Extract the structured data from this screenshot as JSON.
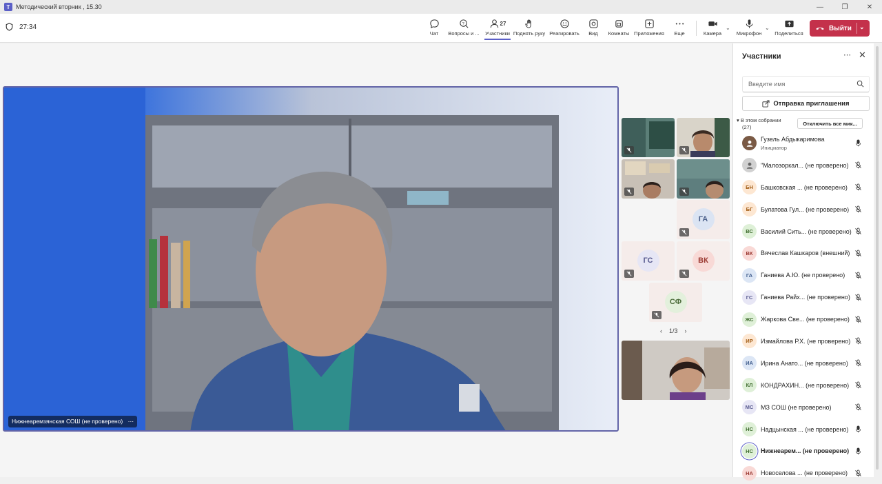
{
  "window": {
    "title": "Методический вторник , 15.30"
  },
  "toolbar": {
    "timer": "27:34",
    "buttons": [
      {
        "label": "Чат",
        "icon": "chat-icon"
      },
      {
        "label": "Вопросы и ...",
        "icon": "qa-icon"
      },
      {
        "label": "Участники",
        "icon": "people-icon",
        "count": "27"
      },
      {
        "label": "Поднять руку",
        "icon": "hand-icon"
      },
      {
        "label": "Реагировать",
        "icon": "smile-icon"
      },
      {
        "label": "Вид",
        "icon": "view-icon"
      },
      {
        "label": "Комнаты",
        "icon": "rooms-icon"
      },
      {
        "label": "Приложения",
        "icon": "apps-icon"
      },
      {
        "label": "Еще",
        "icon": "more-icon"
      },
      {
        "label": "Камера",
        "icon": "camera-icon"
      },
      {
        "label": "Микрофон",
        "icon": "microphone-icon"
      },
      {
        "label": "Поделиться",
        "icon": "share-icon"
      }
    ],
    "leave_label": "Выйти"
  },
  "stage": {
    "main_name": "Нижнеаремзянская СОШ (не проверено)",
    "pager": "1/3",
    "avatar_tiles": [
      {
        "initials": "ГА",
        "bg": "#dbe4f3",
        "fg": "#4a5f8a"
      },
      {
        "initials": "ГС",
        "bg": "#e6e6f5",
        "fg": "#585a8f"
      },
      {
        "initials": "ВК",
        "bg": "#f8d9d6",
        "fg": "#9c3a33"
      },
      {
        "initials": "СФ",
        "bg": "#e3f0dc",
        "fg": "#4a6a38"
      }
    ]
  },
  "panel": {
    "title": "Участники",
    "search_placeholder": "Введите имя",
    "invite_label": "Отправка приглашения",
    "section_label": "В этом собрании",
    "section_count": "(27)",
    "mute_all_label": "Отключить все мик...",
    "participants": [
      {
        "initials": "",
        "name": "Гузель Абдыкаримова",
        "role": "Инициатор",
        "color_bg": "#7a5a45",
        "color_fg": "#fff",
        "mic": "on"
      },
      {
        "initials": "",
        "name": "\"Малозоркал... (не проверено)",
        "role": "",
        "color_bg": "#d1d1d1",
        "color_fg": "#666",
        "mic": "off"
      },
      {
        "initials": "БН",
        "name": "Башковская ... (не проверено)",
        "role": "",
        "color_bg": "#fde7d2",
        "color_fg": "#a05a12",
        "mic": "off"
      },
      {
        "initials": "БГ",
        "name": "Булатова Гул... (не проверено)",
        "role": "",
        "color_bg": "#fde7d2",
        "color_fg": "#a05a12",
        "mic": "off"
      },
      {
        "initials": "ВС",
        "name": "Василий Сить... (не проверено)",
        "role": "",
        "color_bg": "#def0d7",
        "color_fg": "#3d6b2c",
        "mic": "off"
      },
      {
        "initials": "ВК",
        "name": "Вячеслав Кашкаров (внешний)",
        "role": "",
        "color_bg": "#f9d9d6",
        "color_fg": "#9c3a33",
        "mic": "off"
      },
      {
        "initials": "ГА",
        "name": "Ганиева А.Ю. (не проверено)",
        "role": "",
        "color_bg": "#dce6f5",
        "color_fg": "#3e5b8c",
        "mic": "off"
      },
      {
        "initials": "ГС",
        "name": "Ганиева Райх... (не проверено)",
        "role": "",
        "color_bg": "#e7e6f5",
        "color_fg": "#585a8f",
        "mic": "off"
      },
      {
        "initials": "ЖС",
        "name": "Жаркова Све... (не проверено)",
        "role": "",
        "color_bg": "#dff0d8",
        "color_fg": "#3d6b2c",
        "mic": "off"
      },
      {
        "initials": "ИР",
        "name": "Измайлова Р.Х. (не проверено)",
        "role": "",
        "color_bg": "#fde7d2",
        "color_fg": "#a05a12",
        "mic": "off"
      },
      {
        "initials": "ИА",
        "name": "Ирина Анато... (не проверено)",
        "role": "",
        "color_bg": "#dce6f5",
        "color_fg": "#3e5b8c",
        "mic": "off"
      },
      {
        "initials": "КЛ",
        "name": "КОНДРАХИН... (не проверено)",
        "role": "",
        "color_bg": "#dff0d8",
        "color_fg": "#3d6b2c",
        "mic": "off"
      },
      {
        "initials": "МС",
        "name": "МЗ СОШ (не проверено)",
        "role": "",
        "color_bg": "#e7e6f5",
        "color_fg": "#585a8f",
        "mic": "off"
      },
      {
        "initials": "НС",
        "name": "Надцынская ... (не проверено)",
        "role": "",
        "color_bg": "#dff0d8",
        "color_fg": "#3d6b2c",
        "mic": "on"
      },
      {
        "initials": "НС",
        "name": "Нижнеарем... (не проверено)",
        "role": "",
        "color_bg": "#dff0d8",
        "color_fg": "#3d6b2c",
        "mic": "on",
        "active": true
      },
      {
        "initials": "НА",
        "name": "Новоселова ... (не проверено)",
        "role": "",
        "color_bg": "#f9d9d6",
        "color_fg": "#9c3a33",
        "mic": "off"
      }
    ]
  }
}
